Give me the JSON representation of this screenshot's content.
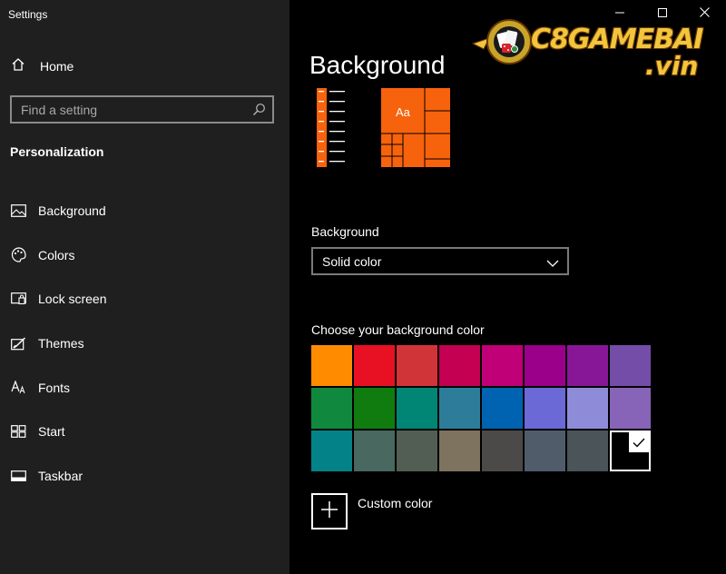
{
  "window": {
    "title": "Settings"
  },
  "sidebar": {
    "home_label": "Home",
    "search_placeholder": "Find a setting",
    "section_title": "Personalization",
    "items": [
      {
        "label": "Background",
        "icon": "picture-icon"
      },
      {
        "label": "Colors",
        "icon": "palette-icon"
      },
      {
        "label": "Lock screen",
        "icon": "lock-screen-icon"
      },
      {
        "label": "Themes",
        "icon": "themes-icon"
      },
      {
        "label": "Fonts",
        "icon": "fonts-icon"
      },
      {
        "label": "Start",
        "icon": "start-icon"
      },
      {
        "label": "Taskbar",
        "icon": "taskbar-icon"
      }
    ]
  },
  "logo": {
    "text": "C8GAMEBAI",
    "sub": ".vin"
  },
  "main": {
    "title": "Background",
    "preview_text": "Aa",
    "background_label": "Background",
    "background_value": "Solid color",
    "choose_label": "Choose your background color",
    "custom_label": "Custom color"
  },
  "colors": {
    "accent": "#f7630c",
    "swatches": [
      "#ff8c00",
      "#e81123",
      "#d13438",
      "#c30052",
      "#bf0077",
      "#9a0089",
      "#881798",
      "#744da9",
      "#10893e",
      "#107c10",
      "#018574",
      "#2d7d9a",
      "#0063b1",
      "#6b69d6",
      "#8e8cd8",
      "#8764b8",
      "#038387",
      "#486860",
      "#525e54",
      "#7e735f",
      "#4c4a48",
      "#515c6b",
      "#4a5459",
      "#000000"
    ],
    "selected_index": 23
  }
}
